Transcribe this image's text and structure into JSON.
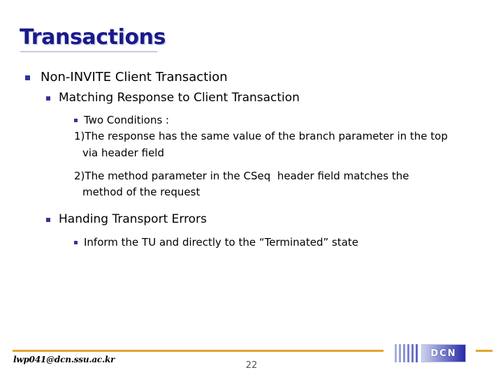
{
  "slide": {
    "title": "Transactions",
    "page_number": "22",
    "accent_color": "#E0A52E",
    "title_color": "#1A1A8C",
    "bullet_color": "#333399"
  },
  "outline": {
    "level1": {
      "label": "Non-INVITE Client Transaction"
    },
    "section_matching": {
      "label": "Matching Response to Client Transaction",
      "sub_label": "Two Conditions :",
      "conditions": [
        {
          "number": "1)",
          "text": "The response has the same value of the branch parameter in the top",
          "continuation": "via header field"
        },
        {
          "number": "2)",
          "text": "The method parameter in the CSeq  header field matches the",
          "continuation": "method of the request"
        }
      ]
    },
    "section_errors": {
      "label": "Handing Transport Errors",
      "sub_label": "Inform the TU and directly to the “Terminated” state"
    }
  },
  "footer": {
    "email": "lwp041@dcn.ssu.ac.kr",
    "logo_text": "DCN"
  }
}
